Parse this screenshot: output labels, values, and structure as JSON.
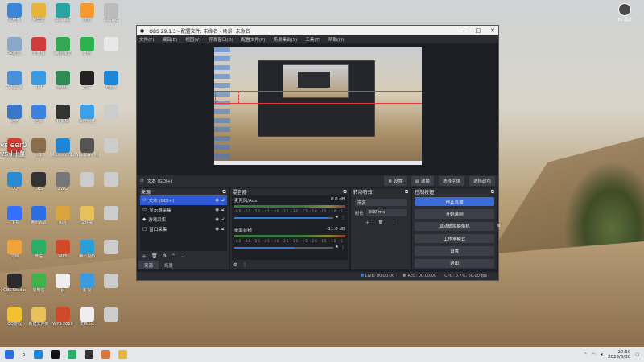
{
  "desktop": {
    "icons": [
      {
        "label": "此电脑",
        "color": "#3b86d6"
      },
      {
        "label": "阿里云",
        "color": "#e8b33a"
      },
      {
        "label": "Quicker",
        "color": "#2aa4a0"
      },
      {
        "label": "搜狗",
        "color": "#f29a2e"
      },
      {
        "label": "coding",
        "color": "#bbbbbb"
      },
      {
        "label": "回收站",
        "color": "#8aa6c8"
      },
      {
        "label": "爱剪辑",
        "color": "#d23b3b"
      },
      {
        "label": "腾讯课堂",
        "color": "#32a852"
      },
      {
        "label": "音乐",
        "color": "#2bb24c"
      },
      {
        "label": "",
        "color": "#e8e8e8"
      },
      {
        "label": "控制面板",
        "color": "#4a8fd8"
      },
      {
        "label": "TIM",
        "color": "#3a9be0"
      },
      {
        "label": "Studio",
        "color": "#2e8b57"
      },
      {
        "label": "剪映",
        "color": "#222222"
      },
      {
        "label": "Edge",
        "color": "#1f86d6"
      },
      {
        "label": "网络",
        "color": "#3a77c9"
      },
      {
        "label": "迅雷",
        "color": "#3b82e0"
      },
      {
        "label": "快剪辑",
        "color": "#333333"
      },
      {
        "label": "百度网盘",
        "color": "#3aa0e8"
      },
      {
        "label": "",
        "color": "#cccccc"
      },
      {
        "label": "网易云音乐",
        "color": "#d43c33"
      },
      {
        "label": "pi1",
        "color": "#8a6d4c"
      },
      {
        "label": "Microsoft Edge",
        "color": "#1f86d6"
      },
      {
        "label": "Windows Media",
        "color": "#555555"
      },
      {
        "label": "",
        "color": "#cccccc"
      },
      {
        "label": "QQ",
        "color": "#2a8ad4"
      },
      {
        "label": "OBS",
        "color": "#333333"
      },
      {
        "label": "ZWG",
        "color": "#777777"
      },
      {
        "label": "",
        "color": "#cccccc"
      },
      {
        "label": "",
        "color": "#cccccc"
      },
      {
        "label": "飞书",
        "color": "#3370ff"
      },
      {
        "label": "腾讯会议",
        "color": "#2b6de3"
      },
      {
        "label": "图片",
        "color": "#d9a43b"
      },
      {
        "label": "文件夹",
        "color": "#e8c15a"
      },
      {
        "label": "",
        "color": "#cccccc"
      },
      {
        "label": "文档",
        "color": "#f0a23b"
      },
      {
        "label": "微信",
        "color": "#2aae67"
      },
      {
        "label": "WPS",
        "color": "#d04a2a"
      },
      {
        "label": "腾讯视频",
        "color": "#2a9fd6"
      },
      {
        "label": "",
        "color": "#cccccc"
      },
      {
        "label": "OBS Studio",
        "color": "#2b2b2b"
      },
      {
        "label": "爱奇艺",
        "color": "#3fb24c"
      },
      {
        "label": "pi",
        "color": "#eeeeee"
      },
      {
        "label": "影视",
        "color": "#3a9be0"
      },
      {
        "label": "",
        "color": "#cccccc"
      },
      {
        "label": "QQ游戏",
        "color": "#f2c12e"
      },
      {
        "label": "新建文件夹",
        "color": "#e8c15a"
      },
      {
        "label": "WPS 2019",
        "color": "#d04a2a"
      },
      {
        "label": "文档.txt",
        "color": "#eeeeee"
      },
      {
        "label": "",
        "color": "#cccccc"
      }
    ],
    "overlay_lines": [
      "vs eer0",
      "vs 川漂"
    ],
    "widget_label": "7k 毫秒"
  },
  "obs": {
    "title": "OBS 29.1.3 - 配置文件: 未命名 - 场景: 未命名",
    "menu": [
      "文件(F)",
      "编辑(E)",
      "视图(V)",
      "停靠窗口(D)",
      "配置文件(P)",
      "场景集合(S)",
      "工具(T)",
      "帮助(H)"
    ],
    "source_bar": {
      "name": "文本 (GDI+)",
      "buttons": [
        "设置",
        "滤镜",
        "选择字体",
        "选择颜色"
      ]
    },
    "sources": {
      "title": "来源",
      "items": [
        {
          "name": "文本 (GDI+)",
          "selected": true
        },
        {
          "name": "显示器采集",
          "selected": false
        },
        {
          "name": "游戏采集",
          "selected": false
        },
        {
          "name": "窗口采集",
          "selected": false
        }
      ],
      "tabs": [
        "来源",
        "场景"
      ]
    },
    "mixer": {
      "title": "混音器",
      "channels": [
        {
          "name": "麦克风/Aux",
          "db": "0.0 dB",
          "volume": 0.95
        },
        {
          "name": "桌面音频",
          "db": "-11.0 dB",
          "volume": 0.6
        }
      ],
      "ticks": "-60 -55 -50 -45 -40 -35 -30 -25 -20 -15 -10 -5 0"
    },
    "transitions": {
      "title": "转场特效",
      "selected": "渐变",
      "duration_label": "时长",
      "duration": "300 ms"
    },
    "controls": {
      "title": "控制按钮",
      "buttons": [
        "停止直播",
        "开始录制",
        "启动虚拟摄像机",
        "工作室模式",
        "设置",
        "退出"
      ]
    },
    "status": {
      "live": "LIVE: 00:00:00",
      "rec": "REC: 00:00:00",
      "cpu": "CPU: 0.7%, 60.00 fps"
    }
  },
  "taskbar": {
    "time": "20:50",
    "date": "2023/8/30"
  }
}
